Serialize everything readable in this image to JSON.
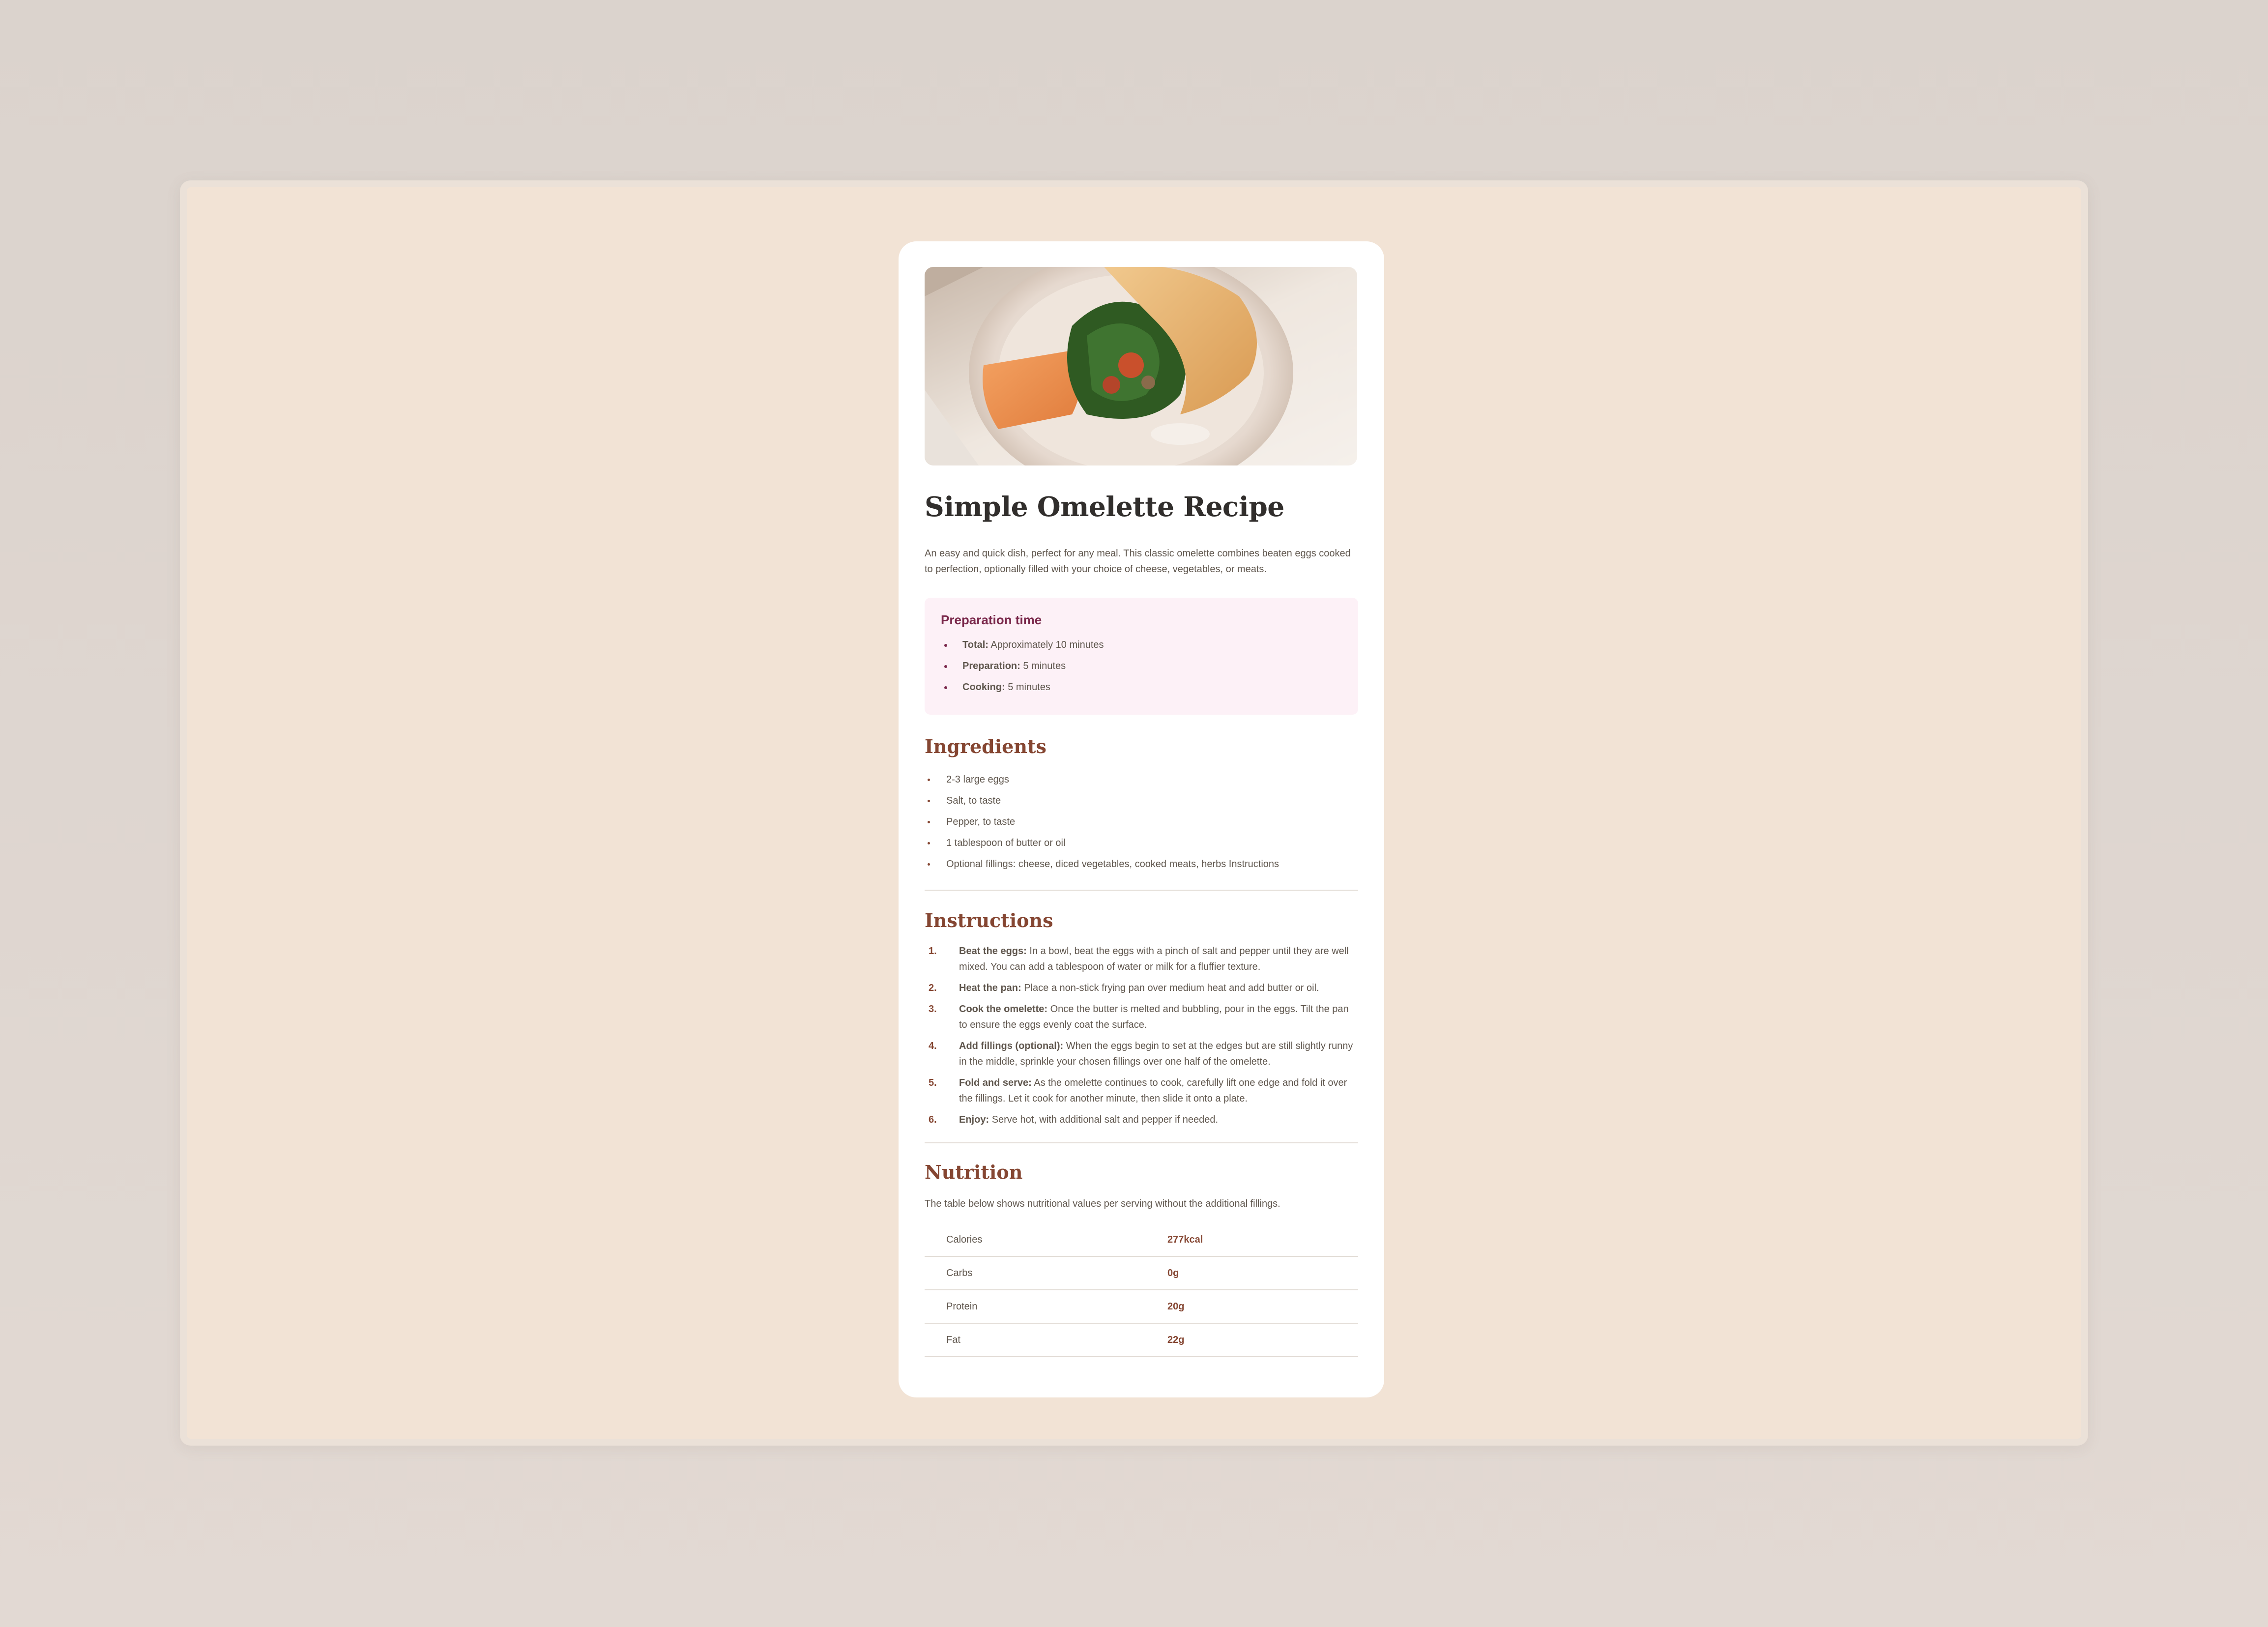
{
  "recipe": {
    "title": "Simple Omelette Recipe",
    "intro": "An easy and quick dish, perfect for any meal. This classic omelette combines beaten eggs cooked to perfection, optionally filled with your choice of cheese, vegetables, or meats.",
    "image_icon": "omelette-photo"
  },
  "prep": {
    "heading": "Preparation time",
    "items": [
      {
        "label": "Total:",
        "value": "Approximately 10 minutes"
      },
      {
        "label": "Preparation:",
        "value": "5 minutes"
      },
      {
        "label": "Cooking:",
        "value": "5 minutes"
      }
    ]
  },
  "ingredients": {
    "heading": "Ingredients",
    "items": [
      "2-3 large eggs",
      "Salt, to taste",
      "Pepper, to taste",
      "1 tablespoon of butter or oil",
      "Optional fillings: cheese, diced vegetables, cooked meats, herbs Instructions"
    ]
  },
  "instructions": {
    "heading": "Instructions",
    "steps": [
      {
        "num": "1.",
        "title": "Beat the eggs:",
        "text": "In a bowl, beat the eggs with a pinch of salt and pepper until they are well mixed. You can add a tablespoon of water or milk for a fluffier texture."
      },
      {
        "num": "2.",
        "title": "Heat the pan:",
        "text": "Place a non-stick frying pan over medium heat and add butter or oil."
      },
      {
        "num": "3.",
        "title": "Cook the omelette:",
        "text": "Once the butter is melted and bubbling, pour in the eggs. Tilt the pan to ensure the eggs evenly coat the surface."
      },
      {
        "num": "4.",
        "title": "Add fillings (optional):",
        "text": "When the eggs begin to set at the edges but are still slightly runny in the middle, sprinkle your chosen fillings over one half of the omelette."
      },
      {
        "num": "5.",
        "title": "Fold and serve:",
        "text": "As the omelette continues to cook, carefully lift one edge and fold it over the fillings. Let it cook for another minute, then slide it onto a plate."
      },
      {
        "num": "6.",
        "title": "Enjoy:",
        "text": "Serve hot, with additional salt and pepper if needed."
      }
    ]
  },
  "nutrition": {
    "heading": "Nutrition",
    "intro": "The table below shows nutritional values per serving without the additional fillings.",
    "rows": [
      {
        "label": "Calories",
        "value": "277kcal"
      },
      {
        "label": "Carbs",
        "value": "0g"
      },
      {
        "label": "Protein",
        "value": "20g"
      },
      {
        "label": "Fat",
        "value": "22g"
      }
    ]
  },
  "colors": {
    "page_bg": "#f2e3d5",
    "card_bg": "#ffffff",
    "heading_dark": "#312e2c",
    "accent_brown": "#854632",
    "prep_bg": "#fdf1f7",
    "prep_accent": "#7a284b"
  }
}
